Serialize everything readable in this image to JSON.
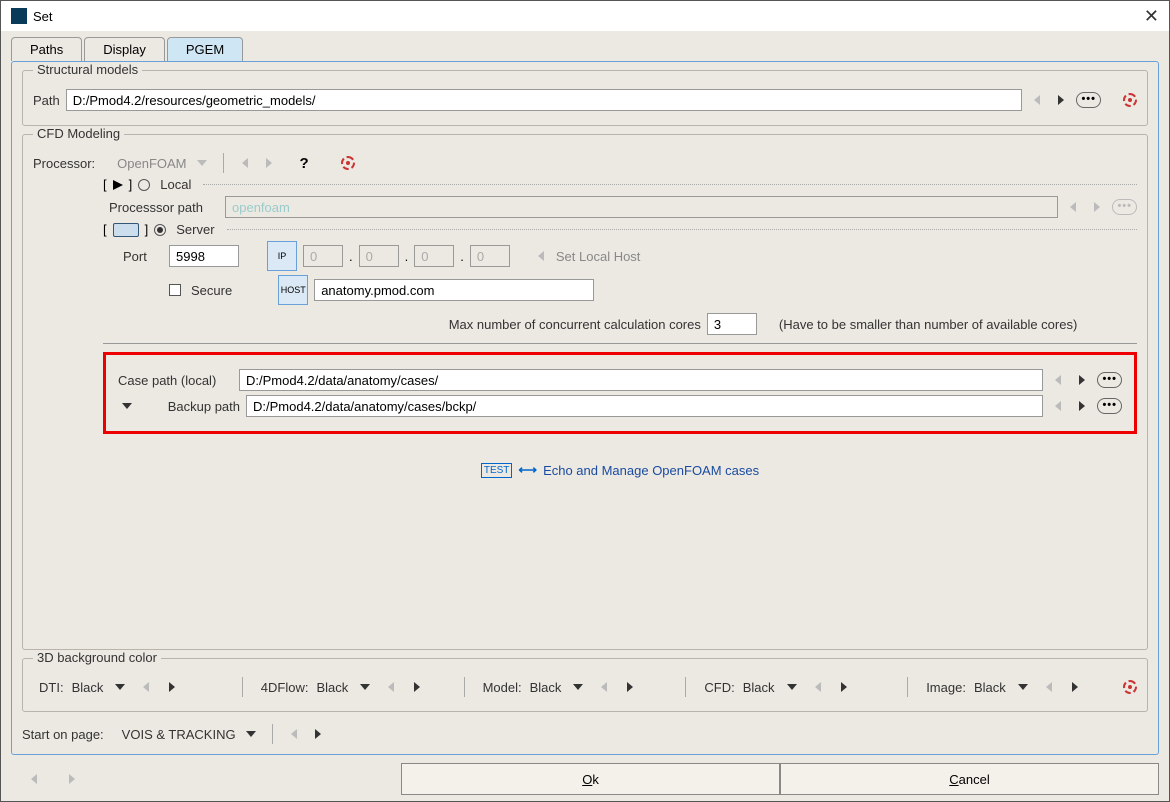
{
  "window": {
    "title": "Set"
  },
  "tabs": {
    "paths": "Paths",
    "display": "Display",
    "pgem": "PGEM"
  },
  "structural": {
    "legend": "Structural models",
    "path_label": "Path",
    "path": "D:/Pmod4.2/resources/geometric_models/"
  },
  "cfd": {
    "legend": "CFD Modeling",
    "processor_label": "Processor:",
    "processor_value": "OpenFOAM",
    "local_label": "Local",
    "procpath_label": "Processsor path",
    "procpath_value": "openfoam",
    "server_label": "Server",
    "port_label": "Port",
    "port_value": "5998",
    "ip0": "0",
    "ip1": "0",
    "ip2": "0",
    "ip3": "0",
    "set_local_host": "Set Local Host",
    "secure_label": "Secure",
    "host_value": "anatomy.pmod.com",
    "maxcores_label": "Max number of concurrent calculation cores",
    "maxcores_value": "3",
    "maxcores_note": "(Have to be smaller than number of available cores)",
    "casepath_label": "Case path (local)",
    "casepath_value": "D:/Pmod4.2/data/anatomy/cases/",
    "backuppath_label": "Backup path",
    "backuppath_value": "D:/Pmod4.2/data/anatomy/cases/bckp/",
    "echo_label": "Echo and Manage OpenFOAM cases"
  },
  "bgcolor": {
    "legend": "3D background color",
    "dti": "DTI:",
    "flow": "4DFlow:",
    "model": "Model:",
    "cfd": "CFD:",
    "image": "Image:",
    "black": "Black"
  },
  "start": {
    "label": "Start on page:",
    "value": "VOIS & TRACKING"
  },
  "buttons": {
    "ok": "Ok",
    "cancel": "Cancel"
  }
}
